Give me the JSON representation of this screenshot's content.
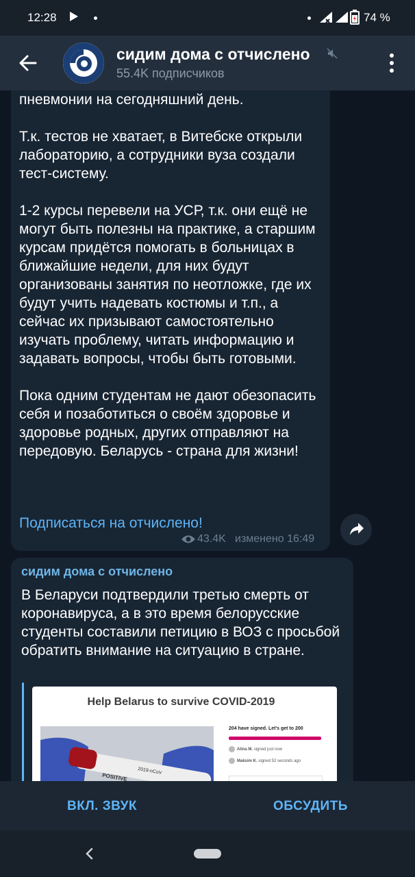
{
  "status_bar": {
    "time": "12:28",
    "battery": "74 %"
  },
  "header": {
    "title": "сидим дома с отчислено",
    "subscribers": "55.4K подписчиков"
  },
  "message1": {
    "text": "пневмонии на сегодняшний день.\n\nТ.к. тестов не хватает, в Витебске открыли лабораторию, а сотрудники вуза создали тест-систему.\n\n1-2 курсы перевели на УСР, т.к. они ещё не могут быть полезны на практике, а старшим курсам придётся помогать в больницах в ближайшие недели, для них будут организованы занятия по неотложке, где их будут учить надевать костюмы и т.п., а сейчас их призывают самостоятельно изучать проблему, читать информацию и задавать вопросы, чтобы быть готовыми.\n\nПока одним студентам не дают обезопасить себя и позаботиться о своём здоровье и здоровье родных, других отправляют на передовую. Беларусь - страна для жизни!",
    "link": "Подписаться на отчислено!",
    "views": "43.4K",
    "edited": "изменено 16:49"
  },
  "message2": {
    "author": "сидим дома с отчислено",
    "text": "В Беларуси подтвердили третью смерть от коронавируса, а в это время белорусские студенты составили петицию в ВОЗ с просьбой обратить внимание на ситуацию в стране.",
    "preview": {
      "title": "Help Belarus to survive COVID-2019",
      "signed": "204 have signed. Let's get to 200",
      "signer1": "Alina M.",
      "signer1_time": "signed just now",
      "signer2": "Maksim K.",
      "signer2_time": "signed 52 seconds ago",
      "vial_label1": "2019-nCoV",
      "vial_label2": "POSITIVE"
    }
  },
  "bottom_bar": {
    "sound": "ВКЛ. ЗВУК",
    "discuss": "ОБСУДИТЬ"
  },
  "colors": {
    "accent": "#5eb5f7",
    "bubble": "#182533",
    "background": "#0e1621",
    "header": "#242f3d"
  }
}
